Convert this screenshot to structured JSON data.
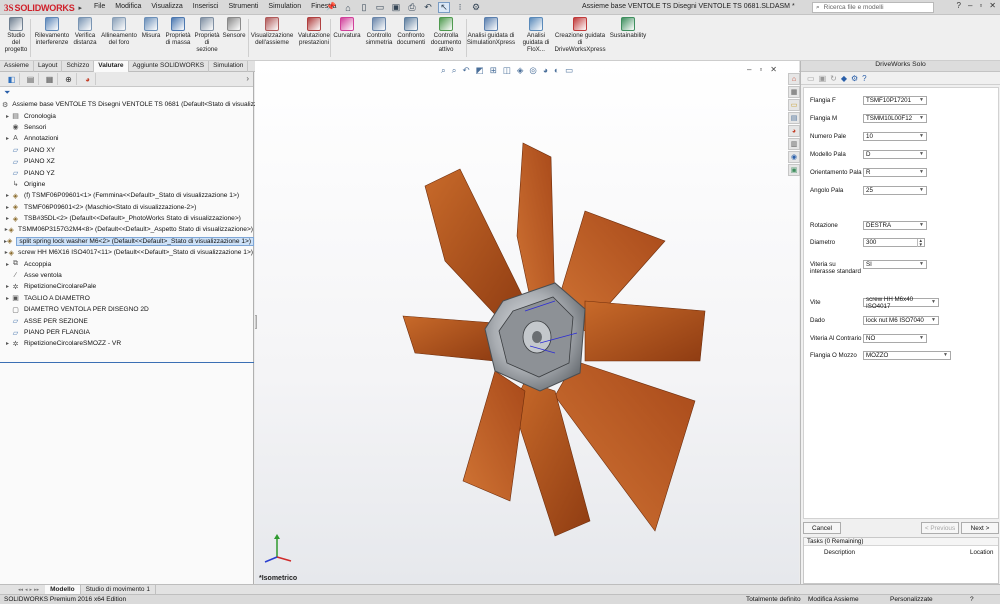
{
  "app": {
    "brand_prefix": "3S",
    "brand_name": "SOLIDWORKS",
    "menu": [
      "File",
      "Modifica",
      "Visualizza",
      "Inserisci",
      "Strumenti",
      "Simulation",
      "Finestra"
    ],
    "document_title": "Assieme base VENTOLE TS Disegni VENTOLE TS 0681.SLDASM *",
    "search_placeholder": "Ricerca file e modelli"
  },
  "ribbon": {
    "buttons": [
      {
        "label": "Studio del progetto",
        "icon": "design-study-icon",
        "color": "#6f7f90"
      },
      {
        "label": "Rilevamento interferenze",
        "icon": "interference-icon",
        "color": "#5d87b8"
      },
      {
        "label": "Verifica distanza",
        "icon": "clearance-icon",
        "color": "#7a95b3"
      },
      {
        "label": "Allineamento del foro",
        "icon": "hole-alignment-icon",
        "color": "#8aa0b8"
      },
      {
        "label": "Misura",
        "icon": "measure-icon",
        "color": "#6b8fb8"
      },
      {
        "label": "Proprietà di massa",
        "icon": "mass-properties-icon",
        "color": "#4c78b0"
      },
      {
        "label": "Proprietà di sezione",
        "icon": "section-properties-icon",
        "color": "#7f8fa2"
      },
      {
        "label": "Sensore",
        "icon": "sensor-icon",
        "color": "#8a8a8a"
      },
      {
        "label": "Visualizzazione dell'assieme",
        "icon": "assembly-visualization-icon",
        "color": "#b05a5a"
      },
      {
        "label": "Valutazione prestazioni",
        "icon": "performance-evaluation-icon",
        "color": "#b04040"
      },
      {
        "label": "Curvatura",
        "icon": "curvature-icon",
        "color": "#d0409a"
      },
      {
        "label": "Controllo simmetria",
        "icon": "symmetry-check-icon",
        "color": "#6a86aa"
      },
      {
        "label": "Confronto documenti",
        "icon": "compare-documents-icon",
        "color": "#5f7f9f"
      },
      {
        "label": "Controlla documento attivo",
        "icon": "check-active-document-icon",
        "color": "#4f9a4f"
      },
      {
        "label": "Analisi guidata di SimulationXpress",
        "icon": "simulationxpress-icon",
        "color": "#5a7fae"
      },
      {
        "label": "Analisi guidata di FloX...",
        "icon": "floxpress-icon",
        "color": "#5a8aba"
      },
      {
        "label": "Creazione guidata di DriveWorksXpress",
        "icon": "driveworksxpress-icon",
        "color": "#c03a3a"
      },
      {
        "label": "Sustainability",
        "icon": "sustainability-icon",
        "color": "#3f8f5f"
      }
    ]
  },
  "command_tabs": [
    "Assieme",
    "Layout",
    "Schizzo",
    "Valutare",
    "Aggiunte SOLIDWORKS",
    "Simulation"
  ],
  "command_tab_active": "Valutare",
  "tree": {
    "items": [
      {
        "label": "Assieme base VENTOLE TS Disegni VENTOLE TS 0681  (Default<Stato di visualizzazione-",
        "indent": 0,
        "twisty": "",
        "icon": "assembly-icon",
        "glyph": "⚙"
      },
      {
        "label": "Cronologia",
        "indent": 1,
        "twisty": "▸",
        "icon": "history-icon",
        "glyph": "▤"
      },
      {
        "label": "Sensori",
        "indent": 1,
        "twisty": "",
        "icon": "sensors-icon",
        "glyph": "◉"
      },
      {
        "label": "Annotazioni",
        "indent": 1,
        "twisty": "▸",
        "icon": "annotations-icon",
        "glyph": "A"
      },
      {
        "label": "PIANO XY",
        "indent": 1,
        "twisty": "",
        "icon": "plane-icon",
        "glyph": "▱"
      },
      {
        "label": "PIANO XZ",
        "indent": 1,
        "twisty": "",
        "icon": "plane-icon",
        "glyph": "▱"
      },
      {
        "label": "PIANO YZ",
        "indent": 1,
        "twisty": "",
        "icon": "plane-icon",
        "glyph": "▱"
      },
      {
        "label": "Origine",
        "indent": 1,
        "twisty": "",
        "icon": "origin-icon",
        "glyph": "↳"
      },
      {
        "label": "(f) TSMF06P09601<1> (Femmina<<Default>_Stato di visualizzazione 1>)",
        "indent": 1,
        "twisty": "▸",
        "icon": "part-icon",
        "glyph": "◈"
      },
      {
        "label": "TSMF06P09601<2> (Maschio<Stato di visualizzazione-2>)",
        "indent": 1,
        "twisty": "▸",
        "icon": "part-icon",
        "glyph": "◈"
      },
      {
        "label": "TSB#35DL<2> (Default<<Default>_PhotoWorks Stato di visualizzazione>)",
        "indent": 1,
        "twisty": "▸",
        "icon": "part-icon",
        "glyph": "◈"
      },
      {
        "label": "TSMM06P3157G2M4<8> (Default<<Default>_Aspetto Stato di visualizzazione>)",
        "indent": 1,
        "twisty": "▸",
        "icon": "part-icon",
        "glyph": "◈"
      },
      {
        "label": "split spring lock washer M6<2> (Default<<Default>_Stato di visualizzazione 1>)",
        "indent": 1,
        "twisty": "▸",
        "icon": "part-icon",
        "glyph": "◈",
        "selected": true
      },
      {
        "label": "screw HH M6X16 ISO4017<11> (Default<<Default>_Stato di visualizzazione 1>)",
        "indent": 1,
        "twisty": "▸",
        "icon": "part-icon",
        "glyph": "◈"
      },
      {
        "label": "Accoppia",
        "indent": 1,
        "twisty": "▸",
        "icon": "mates-icon",
        "glyph": "⧉"
      },
      {
        "label": "Asse ventola",
        "indent": 1,
        "twisty": "",
        "icon": "axis-icon",
        "glyph": "∕"
      },
      {
        "label": "RipetizioneCircolarePale",
        "indent": 1,
        "twisty": "▸",
        "icon": "circular-pattern-icon",
        "glyph": "✲"
      },
      {
        "label": "TAGLIO A DIAMETRO",
        "indent": 1,
        "twisty": "▸",
        "icon": "cut-icon",
        "glyph": "▣"
      },
      {
        "label": "DIAMETRO VENTOLA PER DISEGNO 2D",
        "indent": 1,
        "twisty": "",
        "icon": "sketch-icon",
        "glyph": "▢"
      },
      {
        "label": "ASSE PER SEZIONE",
        "indent": 1,
        "twisty": "",
        "icon": "plane-icon",
        "glyph": "▱"
      },
      {
        "label": "PIANO PER FLANGIA",
        "indent": 1,
        "twisty": "",
        "icon": "plane-icon",
        "glyph": "▱"
      },
      {
        "label": "RipetizioneCircolareSMOZZ - VR",
        "indent": 1,
        "twisty": "▸",
        "icon": "circular-pattern-icon",
        "glyph": "✲"
      }
    ]
  },
  "viewport": {
    "view_label": "*Isometrico",
    "blade_color": "#b5531b",
    "hub_color": "#9fa3a8",
    "annotation_color": "#2b2bd6"
  },
  "driveworks": {
    "title": "DriveWorks Solo",
    "fields": [
      {
        "label": "Flangia F",
        "value": "TSMF10P17201",
        "type": "select"
      },
      {
        "label": "Flangia M",
        "value": "TSMM10L00F12",
        "type": "select"
      },
      {
        "label": "Numero Pale",
        "value": "10",
        "type": "select"
      },
      {
        "label": "Modello Pala",
        "value": "D",
        "type": "select"
      },
      {
        "label": "Orientamento Pala",
        "value": "R",
        "type": "select"
      },
      {
        "label": "Angolo Pala",
        "value": "25",
        "type": "select"
      },
      {
        "label": "Rotazione",
        "value": "DESTRA",
        "type": "select"
      },
      {
        "label": "Diametro",
        "value": "300",
        "type": "spin"
      },
      {
        "label": "Viteria su interasse standard",
        "value": "SI",
        "type": "select"
      },
      {
        "label": "Vite",
        "value": "screw HH M6x40 ISO4017",
        "type": "select"
      },
      {
        "label": "Dado",
        "value": "lock nut M6 ISO7040",
        "type": "select"
      },
      {
        "label": "Viteria Al Contrario",
        "value": "NO",
        "type": "select"
      },
      {
        "label": "Flangia O Mozzo",
        "value": "MOZZO",
        "type": "select"
      }
    ],
    "cancel_label": "Cancel",
    "previous_label": "< Previous",
    "next_label": "Next >",
    "tasks_title": "Tasks (0 Remaining)",
    "tasks_columns": [
      "Description",
      "Location"
    ]
  },
  "bottom_tabs": [
    "Modello",
    "Studio di movimento 1"
  ],
  "bottom_tab_active": "Modello",
  "status": {
    "product": "SOLIDWORKS Premium 2016 x64 Edition",
    "definition": "Totalmente definito",
    "mode": "Modifica Assieme",
    "customize": "Personalizzate"
  }
}
